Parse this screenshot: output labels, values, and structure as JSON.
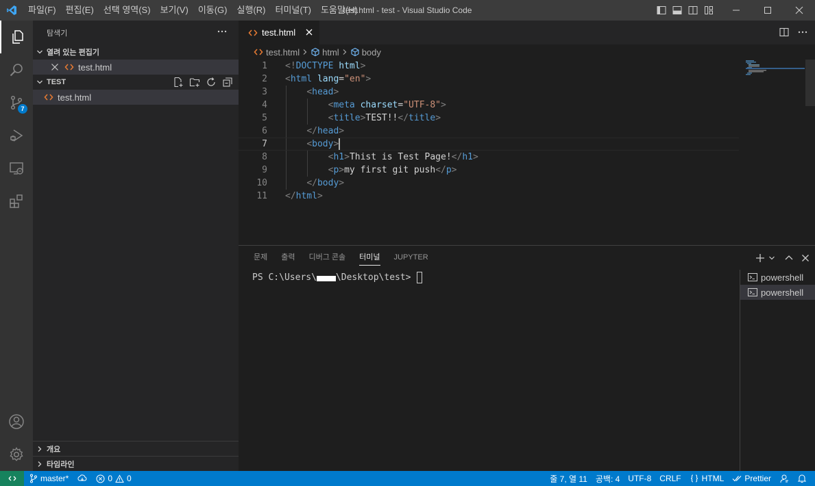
{
  "window": {
    "title": "test.html - test - Visual Studio Code"
  },
  "menu": [
    "파일(F)",
    "편집(E)",
    "선택 영역(S)",
    "보기(V)",
    "이동(G)",
    "실행(R)",
    "터미널(T)",
    "도움말(H)"
  ],
  "activity": {
    "scm_badge": "7"
  },
  "sidebar": {
    "title": "탐색기",
    "open_editors": {
      "header": "열려 있는 편집기",
      "file": "test.html"
    },
    "folder": {
      "header": "TEST",
      "file": "test.html"
    },
    "outline": "개요",
    "timeline": "타임라인"
  },
  "editor": {
    "tab": "test.html",
    "breadcrumb": [
      "test.html",
      "html",
      "body"
    ],
    "lines": [
      {
        "n": "1",
        "parts": [
          [
            "br",
            "<!"
          ],
          [
            "tag",
            "DOCTYPE"
          ],
          [
            "tx",
            " "
          ],
          [
            "at",
            "html"
          ],
          [
            "br",
            ">"
          ]
        ]
      },
      {
        "n": "2",
        "parts": [
          [
            "br",
            "<"
          ],
          [
            "tag",
            "html"
          ],
          [
            "tx",
            " "
          ],
          [
            "at",
            "lang"
          ],
          [
            "tx",
            "="
          ],
          [
            "str",
            "\"en\""
          ],
          [
            "br",
            ">"
          ]
        ]
      },
      {
        "n": "3",
        "parts": [
          [
            "tx",
            "    "
          ],
          [
            "br",
            "<"
          ],
          [
            "tag",
            "head"
          ],
          [
            "br",
            ">"
          ]
        ]
      },
      {
        "n": "4",
        "parts": [
          [
            "tx",
            "        "
          ],
          [
            "br",
            "<"
          ],
          [
            "tag",
            "meta"
          ],
          [
            "tx",
            " "
          ],
          [
            "at",
            "charset"
          ],
          [
            "tx",
            "="
          ],
          [
            "str",
            "\"UTF-8\""
          ],
          [
            "br",
            ">"
          ]
        ]
      },
      {
        "n": "5",
        "parts": [
          [
            "tx",
            "        "
          ],
          [
            "br",
            "<"
          ],
          [
            "tag",
            "title"
          ],
          [
            "br",
            ">"
          ],
          [
            "tx",
            "TEST!!"
          ],
          [
            "br",
            "</"
          ],
          [
            "tag",
            "title"
          ],
          [
            "br",
            ">"
          ]
        ]
      },
      {
        "n": "6",
        "parts": [
          [
            "tx",
            "    "
          ],
          [
            "br",
            "</"
          ],
          [
            "tag",
            "head"
          ],
          [
            "br",
            ">"
          ]
        ]
      },
      {
        "n": "7",
        "parts": [
          [
            "tx",
            "    "
          ],
          [
            "br",
            "<"
          ],
          [
            "tag",
            "body"
          ],
          [
            "br",
            ">"
          ]
        ]
      },
      {
        "n": "8",
        "parts": [
          [
            "tx",
            "        "
          ],
          [
            "br",
            "<"
          ],
          [
            "tag",
            "h1"
          ],
          [
            "br",
            ">"
          ],
          [
            "tx",
            "Thist is Test Page!"
          ],
          [
            "br",
            "</"
          ],
          [
            "tag",
            "h1"
          ],
          [
            "br",
            ">"
          ]
        ]
      },
      {
        "n": "9",
        "parts": [
          [
            "tx",
            "        "
          ],
          [
            "br",
            "<"
          ],
          [
            "tag",
            "p"
          ],
          [
            "br",
            ">"
          ],
          [
            "tx",
            "my first git push"
          ],
          [
            "br",
            "</"
          ],
          [
            "tag",
            "p"
          ],
          [
            "br",
            ">"
          ]
        ]
      },
      {
        "n": "10",
        "parts": [
          [
            "tx",
            "    "
          ],
          [
            "br",
            "</"
          ],
          [
            "tag",
            "body"
          ],
          [
            "br",
            ">"
          ]
        ]
      },
      {
        "n": "11",
        "parts": [
          [
            "br",
            "</"
          ],
          [
            "tag",
            "html"
          ],
          [
            "br",
            ">"
          ]
        ]
      }
    ],
    "current_line": 7
  },
  "panel": {
    "tabs": [
      "문제",
      "출력",
      "디버그 콘솔",
      "터미널",
      "JUPYTER"
    ],
    "active_tab": 3,
    "prompt_before": "PS C:\\Users\\",
    "prompt_after": "\\Desktop\\test>",
    "terminals": [
      "powershell",
      "powershell"
    ]
  },
  "status": {
    "branch": "master*",
    "errors": "0",
    "warnings": "0",
    "position": "줄 7, 열 11",
    "spaces": "공백: 4",
    "encoding": "UTF-8",
    "eol": "CRLF",
    "language": "HTML",
    "prettier": "Prettier"
  },
  "colors": {
    "accent": "#007acc",
    "remote": "#16825d",
    "titlebar": "#3c3c3c",
    "activitybar": "#333333",
    "sidebar": "#252526",
    "editor": "#1e1e1e"
  }
}
